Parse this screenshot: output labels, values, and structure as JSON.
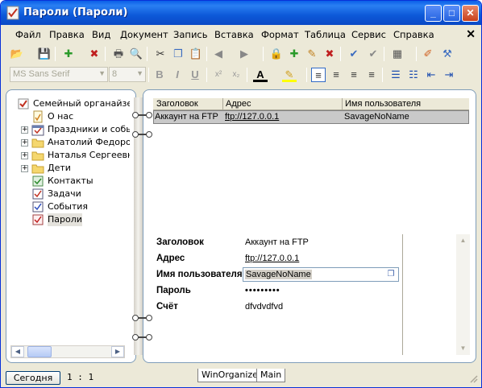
{
  "window": {
    "title": "Пароли (Пароли)"
  },
  "menu": [
    "Файл",
    "Правка",
    "Вид",
    "Документ",
    "Запись",
    "Вставка",
    "Формат",
    "Таблица",
    "Сервис",
    "Справка"
  ],
  "toolbar2": {
    "font_name": "MS Sans Serif",
    "font_size": "8"
  },
  "tree": {
    "root": "Семейный органайзер",
    "items": [
      {
        "label": "О нас"
      },
      {
        "label": "Праздники и события"
      },
      {
        "label": "Анатолий Федоров"
      },
      {
        "label": "Наталья Сергеевна"
      },
      {
        "label": "Дети"
      },
      {
        "label": "Контакты"
      },
      {
        "label": "Задачи"
      },
      {
        "label": "События"
      },
      {
        "label": "Пароли"
      }
    ]
  },
  "grid": {
    "columns": [
      "Заголовок",
      "Адрес",
      "Имя пользователя"
    ],
    "rows": [
      {
        "title": "Аккаунт на FTP",
        "address": "ftp://127.0.0.1",
        "username": "SavageNoName"
      }
    ]
  },
  "detail": {
    "title_label": "Заголовок",
    "title_value": "Аккаунт на FTP",
    "address_label": "Адрес",
    "address_value": "ftp://127.0.0.1",
    "username_label": "Имя пользователя",
    "username_value": "SavageNoName",
    "password_label": "Пароль",
    "password_value": "•••••••••",
    "account_label": "Счёт",
    "account_value": "dfvdvdfvd"
  },
  "status": {
    "today_button": "Сегодня",
    "zoom": "1 : 1",
    "tabs": [
      "WinOrganizer",
      "Main"
    ]
  },
  "colors": {
    "titlebar": "#0a5fe8",
    "frame": "#ece9d8",
    "border": "#7f9db9"
  }
}
